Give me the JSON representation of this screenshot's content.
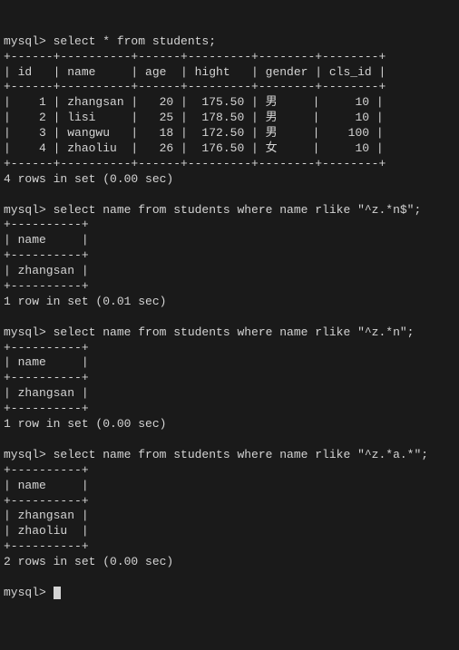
{
  "q1": {
    "prompt": "mysql> ",
    "query": "select * from students;",
    "sep": "+------+----------+------+---------+--------+--------+",
    "header": "| id   | name     | age  | hight   | gender | cls_id |",
    "rows": [
      "|    1 | zhangsan |   20 |  175.50 | 男     |     10 |",
      "|    2 | lisi     |   25 |  178.50 | 男     |     10 |",
      "|    3 | wangwu   |   18 |  172.50 | 男     |    100 |",
      "|    4 | zhaoliu  |   26 |  176.50 | 女     |     10 |"
    ],
    "footer": "4 rows in set (0.00 sec)"
  },
  "q2": {
    "prompt": "mysql> ",
    "query": "select name from students where name rlike \"^z.*n$\";",
    "sep": "+----------+",
    "header": "| name     |",
    "rows": [
      "| zhangsan |"
    ],
    "footer": "1 row in set (0.01 sec)"
  },
  "q3": {
    "prompt": "mysql> ",
    "query": "select name from students where name rlike \"^z.*n\";",
    "sep": "+----------+",
    "header": "| name     |",
    "rows": [
      "| zhangsan |"
    ],
    "footer": "1 row in set (0.00 sec)"
  },
  "q4": {
    "prompt": "mysql> ",
    "query": "select name from students where name rlike \"^z.*a.*\";",
    "sep": "+----------+",
    "header": "| name     |",
    "rows": [
      "| zhangsan |",
      "| zhaoliu  |"
    ],
    "footer": "2 rows in set (0.00 sec)"
  },
  "final_prompt": "mysql> "
}
